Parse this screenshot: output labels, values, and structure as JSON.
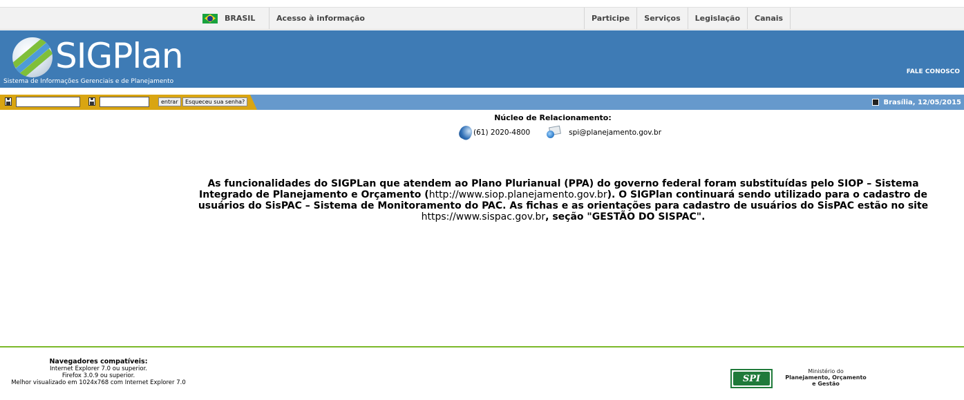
{
  "govbar": {
    "brasil": "BRASIL",
    "acesso": "Acesso à informação",
    "links": [
      "Participe",
      "Serviços",
      "Legislação",
      "Canais"
    ]
  },
  "header": {
    "logo_text": "SIGPlan",
    "subtitle": "Sistema de Informações Gerenciais e de Planejamento",
    "fale_conosco": "FALE CONOSCO"
  },
  "login": {
    "user_value": "",
    "password_value": "",
    "entrar_label": "entrar",
    "esqueceu_label": "Esqueceu sua senha?",
    "date_text": "Brasília, 12/05/2015"
  },
  "contact": {
    "title": "Núcleo de Relacionamento:",
    "phone": "(61) 2020-4800",
    "email": "spi@planejamento.gov.br"
  },
  "message": {
    "part1": "As funcionalidades do SIGPLan que atendem ao Plano Plurianual (PPA) do governo federal foram substituídas pelo SIOP – Sistema Integrado de Planejamento e Orçamento (",
    "link1": "http://www.siop.planejamento.gov.br",
    "part2": "). O SIGPlan continuará sendo utilizado para o cadastro de usuários do SisPAC – Sistema de Monitoramento do PAC. As fichas e as orientações para cadastro de usuários do SisPAC estão no site ",
    "link2": "https://www.sispac.gov.br",
    "part3": ", seção \"GESTÃO DO SISPAC\"."
  },
  "footer": {
    "title": "Navegadores compatíveis:",
    "lines": [
      "Internet Explorer 7.0 ou superior.",
      "Firefox 3.0.9 ou superior.",
      "Melhor visualizado em 1024x768 com Internet Explorer 7.0"
    ],
    "spi_logo": "SPI",
    "ministerio_line1": "Ministério do",
    "ministerio_line2": "Planejamento, Orçamento",
    "ministerio_line3": "e Gestão"
  },
  "colors": {
    "header_blue": "#3e7bb5",
    "loginbar_blue": "#6699cc",
    "login_gold": "#d9a512",
    "footer_green": "#7ab829"
  }
}
